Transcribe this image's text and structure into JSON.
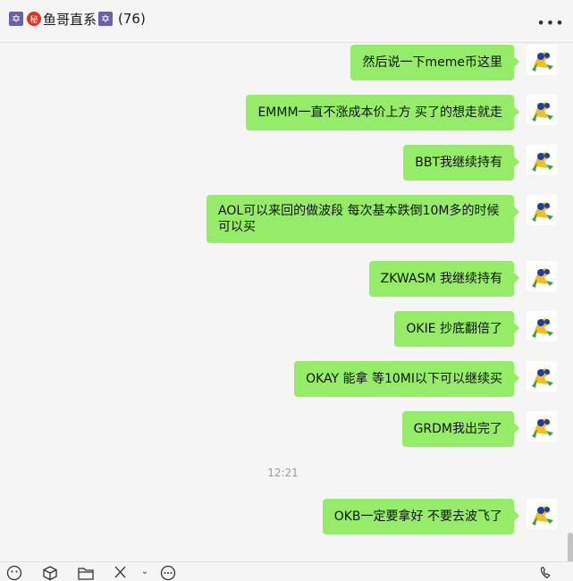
{
  "header": {
    "title": "鱼哥直系",
    "seal_char": "秘",
    "star_char": "✡",
    "member_count": "(76)",
    "more_label": "•••"
  },
  "messages": [
    {
      "text": "然后说一下meme币这里"
    },
    {
      "text": "EMMM一直不涨成本价上方  买了的想走就走"
    },
    {
      "text": "BBT我继续持有"
    },
    {
      "text": "AOL可以来回的做波段  每次基本跌倒10M多的时候可以买"
    },
    {
      "text": "ZKWASM  我继续持有"
    },
    {
      "text": "OKIE  抄底翻倍了"
    },
    {
      "text": "OKAY  能拿    等10MI以下可以继续买"
    },
    {
      "text": "GRDM我出完了"
    },
    {
      "text": "OKB一定要拿好 不要去波飞了"
    }
  ],
  "timestamp": "12:21",
  "toolbar": {
    "emoji_icon": "emoji-icon",
    "sticker_icon": "cube-icon",
    "folder_icon": "folder-icon",
    "scissors_icon": "scissors-icon",
    "chat_icon": "chat-bubble-icon",
    "call_icon": "phone-icon"
  },
  "colors": {
    "bubble": "#95ec69",
    "background": "#f5f5f5"
  }
}
